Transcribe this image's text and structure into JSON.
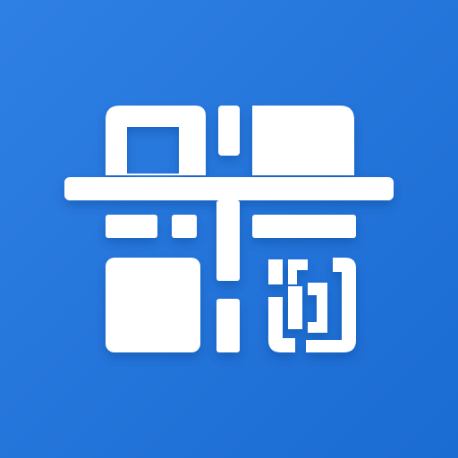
{
  "app_icon": {
    "name": "qr-scanner-app-icon",
    "background_color_top": "#2f80e4",
    "background_color_bottom": "#1a6bd2",
    "glyph_color": "#ffffff",
    "icon": "qr-code-scan-icon"
  }
}
